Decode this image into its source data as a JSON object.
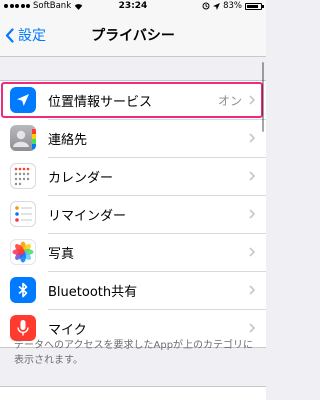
{
  "status_bar": {
    "carrier": "SoftBank",
    "time": "23:24",
    "battery_percent_label": "83%",
    "battery_level": 0.83
  },
  "nav": {
    "back_label": "設定",
    "title": "プライバシー"
  },
  "rows": [
    {
      "label": "位置情報サービス",
      "value": "オン",
      "icon": "location-arrow-icon",
      "color": "#007aff"
    },
    {
      "label": "連絡先",
      "icon": "contacts-icon",
      "color": "#8e8e93"
    },
    {
      "label": "カレンダー",
      "icon": "calendar-icon",
      "color": "#ffffff"
    },
    {
      "label": "リマインダー",
      "icon": "reminders-icon",
      "color": "#ffffff"
    },
    {
      "label": "写真",
      "icon": "photos-icon",
      "color": "#ffffff"
    },
    {
      "label": "Bluetooth共有",
      "icon": "bluetooth-icon",
      "color": "#007aff"
    },
    {
      "label": "マイク",
      "icon": "microphone-icon",
      "color": "#ff3b30"
    }
  ],
  "footer_note": "データへのアクセスを要求したAppが上のカテゴリに表示されます。",
  "highlight_color": "#ec2d7d"
}
